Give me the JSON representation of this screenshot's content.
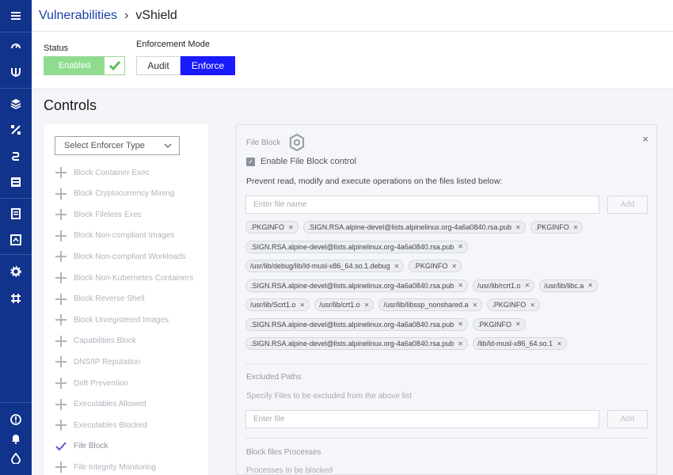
{
  "header": {
    "breadcrumb_link": "Vulnerabilities",
    "breadcrumb_sep": "›",
    "breadcrumb_current": "vShield"
  },
  "status": {
    "label": "Status",
    "toggle_value": "Enabled"
  },
  "enforcement": {
    "label": "Enforcement Mode",
    "audit_label": "Audit",
    "enforce_label": "Enforce"
  },
  "controls": {
    "title": "Controls",
    "select_placeholder": "Select Enforcer Type",
    "items": [
      "Block Container Exec",
      "Block Cryptocurrency Mining",
      "Block Fileless Exec",
      "Block Non-compliant Images",
      "Block Non-compliant Workloads",
      "Block Non-Kubernetes Containers",
      "Block Reverse Shell",
      "Block Unregistered Images",
      "Capabilities Block",
      "DNS/IP Reputation",
      "Drift Prevention",
      "Executables Allowed",
      "Executables Blocked",
      "File Block",
      "File Integrity Monitoring"
    ],
    "selected_item": "File Block"
  },
  "file_block": {
    "title": "File Block",
    "close": "×",
    "enable_label": "Enable File Block control",
    "description": "Prevent read, modify and execute operations on the files listed below:",
    "input_placeholder": "Enter file name",
    "add_label": "Add",
    "tag_rows": [
      [
        ".PKGINFO",
        ".SIGN.RSA.alpine-devel@lists.alpinelinux.org-4a6a0840.rsa.pub",
        ".PKGINFO"
      ],
      [
        ".SIGN.RSA.alpine-devel@lists.alpinelinux.org-4a6a0840.rsa.pub"
      ],
      [
        "/usr/lib/debug/lib/ld-musl-x86_64.so.1.debug",
        ".PKGINFO"
      ],
      [
        ".SIGN.RSA.alpine-devel@lists.alpinelinux.org-4a6a0840.rsa.pub",
        "/usr/lib/rcrt1.o",
        "/usr/lib/libc.a"
      ],
      [
        "/usr/lib/Scrt1.o",
        "/usr/lib/crt1.o",
        "/usr/lib/libssp_nonshared.a",
        ".PKGINFO"
      ],
      [
        ".SIGN.RSA.alpine-devel@lists.alpinelinux.org-4a6a0840.rsa.pub",
        ".PKGINFO"
      ],
      [
        ".SIGN.RSA.alpine-devel@lists.alpinelinux.org-4a6a0840.rsa.pub",
        "/lib/ld-musl-x86_64.so.1"
      ]
    ],
    "excluded": {
      "title": "Excluded Paths",
      "description": "Specify Files to be excluded from the above list",
      "input_placeholder": "Enter file",
      "add_label": "Add"
    },
    "processes": {
      "title": "Block files Processes",
      "description": "Processes to be blocked"
    }
  },
  "colors": {
    "sidebar": "#12338b",
    "enforce_active": "#1a1aff",
    "enabled_green": "#8fdc8f",
    "link": "#1a3fa8"
  }
}
